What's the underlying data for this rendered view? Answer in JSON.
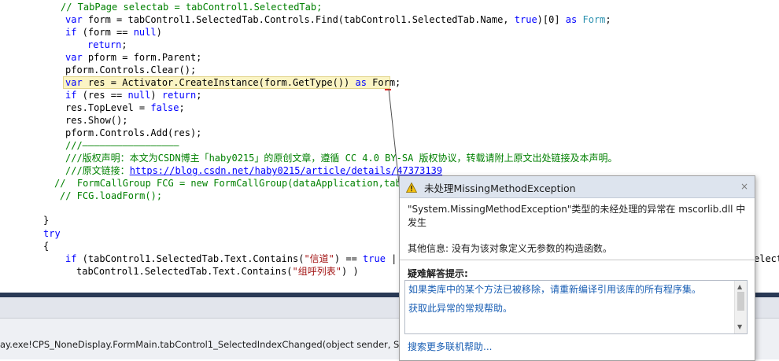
{
  "code": {
    "l1_comment": "// TabPage selectab = tabControl1.SelectedTab;",
    "l2_kw": "var",
    "l2_a": " form = tabControl1.SelectedTab.Controls.Find(tabControl1.SelectedTab.Name, ",
    "l2_true": "true",
    "l2_b": ")[0] ",
    "l2_as": "as",
    "l2_sp": " ",
    "l2_type": "Form",
    "l2_end": ";",
    "l3_if": "if",
    "l3_a": " (form == ",
    "l3_null": "null",
    "l3_b": ")",
    "l4_return": "return",
    "l4_end": ";",
    "l5_var": "var",
    "l5_a": " pform = form.Parent;",
    "l6": "pform.Controls.Clear();",
    "l7_var": "var",
    "l7_a": " res = Activator.CreateInstance(form.GetType()) ",
    "l7_as": "as",
    "l7_b": " Form;",
    "l8_if": "if",
    "l8_a": " (res == ",
    "l8_null": "null",
    "l8_b": ") ",
    "l8_return": "return",
    "l8_end": ";",
    "l9_a": "res.TopLevel = ",
    "l9_false": "false",
    "l9_end": ";",
    "l10": "res.Show();",
    "l11": "pform.Controls.Add(res);",
    "l12_comment": "///—————————————————",
    "l13_comment": "///版权声明：本文为CSDN博主「haby0215」的原创文章，遵循 CC 4.0 BY-SA 版权协议，转载请附上原文出处链接及本声明。",
    "l14_comment": "///原文链接：",
    "l14_link": "https://blog.csdn.net/haby0215/article/details/47373139",
    "l15_comment": "//  FormCallGroup FCG = new FormCallGroup(dataApplication,tabCo",
    "l16_comment": "// FCG.loadForm();",
    "l17": "}",
    "l18_try": "try",
    "l19": "{",
    "l20_if": "if",
    "l20_a": " (tabControl1.SelectedTab.Text.Contains(",
    "l20_str": "\"信道\"",
    "l20_b": ") == ",
    "l20_true": "true",
    "l20_c": " ||",
    "l20_tail": "elect",
    "l21_a": "tabControl1.SelectedTab.Text.Contains(",
    "l21_str": "\"组呼列表\"",
    "l21_b": ") )"
  },
  "callstack_text": "ay.exe!CPS_NoneDisplay.FormMain.tabControl1_SelectedIndexChanged(object sender, System.E",
  "dialog": {
    "title": "未处理MissingMethodException",
    "close_glyph": "×",
    "message_line1": "\"System.MissingMethodException\"类型的未经处理的异常在 mscorlib.dll 中",
    "message_line2": "发生",
    "extra_info": "其他信息: 没有为该对象定义无参数的构造函数。",
    "tips_heading": "疑难解答提示:",
    "tips": [
      "如果类库中的某个方法已被移除，请重新编译引用该库的所有程序集。",
      "获取此异常的常规帮助。"
    ],
    "more_help": "搜索更多联机帮助...",
    "icon": "warning-icon"
  },
  "colors": {
    "keyword": "#0000ff",
    "comment": "#008000",
    "string": "#a31515",
    "type": "#2b91af",
    "highlight": "#fbf4c4",
    "link": "#1a5fb4"
  }
}
